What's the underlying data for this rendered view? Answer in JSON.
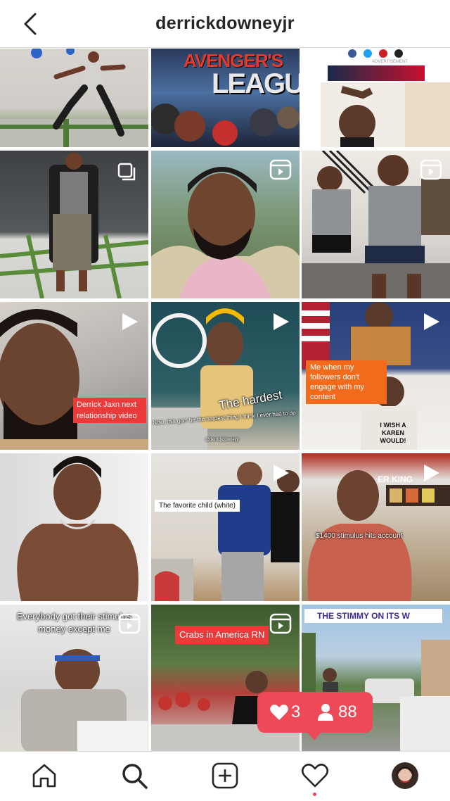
{
  "header": {
    "username": "derrickdowneyjr"
  },
  "tiles": {
    "t2": {
      "poster_top": "AVENGER'S",
      "poster_bottom": "LEAGUE"
    },
    "t3": {
      "ad_label": "ADVERTISEMENT"
    },
    "t7": {
      "caption": "Derrick Jaxn next relationship video"
    },
    "t8": {
      "headline": "The hardest",
      "subtitle": "Now, this gon' be the hardest thing I think I ever had to do",
      "handle": "@derrickdowneyjr"
    },
    "t9": {
      "caption": "Me when my followers don't engage with my content",
      "shirt": "I WISH A KAREN WOULD!"
    },
    "t11": {
      "caption": "The favorite child (white)"
    },
    "t12": {
      "caption": "$1400 stimulus hits account",
      "store_sign": "ER KING"
    },
    "t13": {
      "caption": "Everybody got their stimulus money except me"
    },
    "t14": {
      "caption": "Crabs in America RN"
    },
    "t15": {
      "caption": "THE STIMMY ON ITS W"
    }
  },
  "notification": {
    "likes": "3",
    "followers": "88"
  },
  "colors": {
    "accent": "#ed4956",
    "caption_red": "#ea3a3a"
  },
  "icons": [
    "back-icon",
    "reel-icon",
    "carousel-icon",
    "play-icon",
    "home-icon",
    "search-icon",
    "new-post-icon",
    "heart-icon",
    "profile-avatar",
    "person-icon"
  ]
}
